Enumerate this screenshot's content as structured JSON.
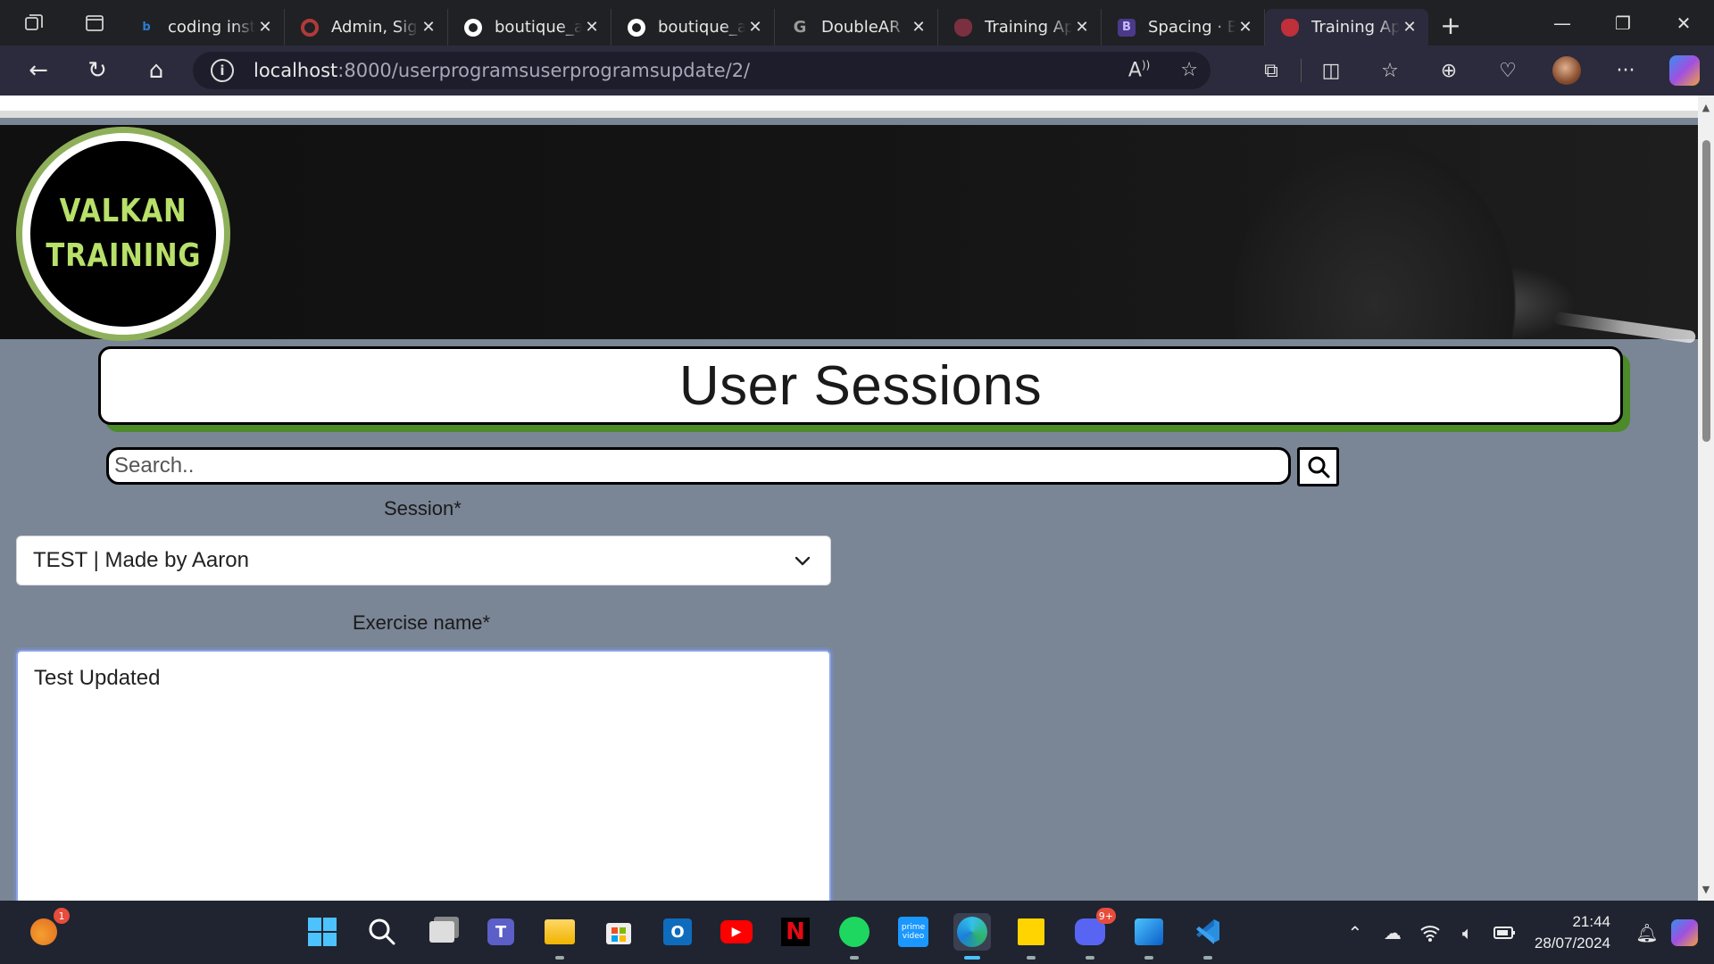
{
  "browser": {
    "tabs": [
      {
        "title": "coding inst",
        "favicon": "bing-icon",
        "color": "#2b7cd3"
      },
      {
        "title": "Admin, Sig",
        "favicon": "circle-icon",
        "color": "#b03a3a"
      },
      {
        "title": "boutique_a",
        "favicon": "github-icon",
        "color": "#ffffff"
      },
      {
        "title": "boutique_a",
        "favicon": "github-icon",
        "color": "#ffffff"
      },
      {
        "title": "DoubleAR",
        "favicon": "g-icon",
        "color": "#888888"
      },
      {
        "title": "Training Ap",
        "favicon": "app-icon",
        "color": "#7a3040"
      },
      {
        "title": "Spacing · B",
        "favicon": "bootstrap-icon",
        "color": "#7952b3"
      },
      {
        "title": "Training Ap",
        "favicon": "app-icon",
        "color": "#c0303a",
        "active": true
      }
    ],
    "url_host": "localhost",
    "url_path": ":8000/userprogramsuserprogramsupdate/2/"
  },
  "page": {
    "logo_line1": "VALKAN",
    "logo_line2": "TRAINING",
    "heading": "User Sessions",
    "search_placeholder": "Search..",
    "session_label": "Session*",
    "session_value": "TEST | Made by Aaron",
    "exercise_label": "Exercise name*",
    "exercise_value": "Test Updated"
  },
  "taskbar": {
    "weather_badge": "1",
    "discord_badge": "9+",
    "time": "21:44",
    "date": "28/07/2024"
  },
  "colors": {
    "page_bg": "#7a8595",
    "accent_shadow": "#4d8a2a",
    "logo_ring": "#8fb05a",
    "logo_text": "#b8e06a"
  }
}
